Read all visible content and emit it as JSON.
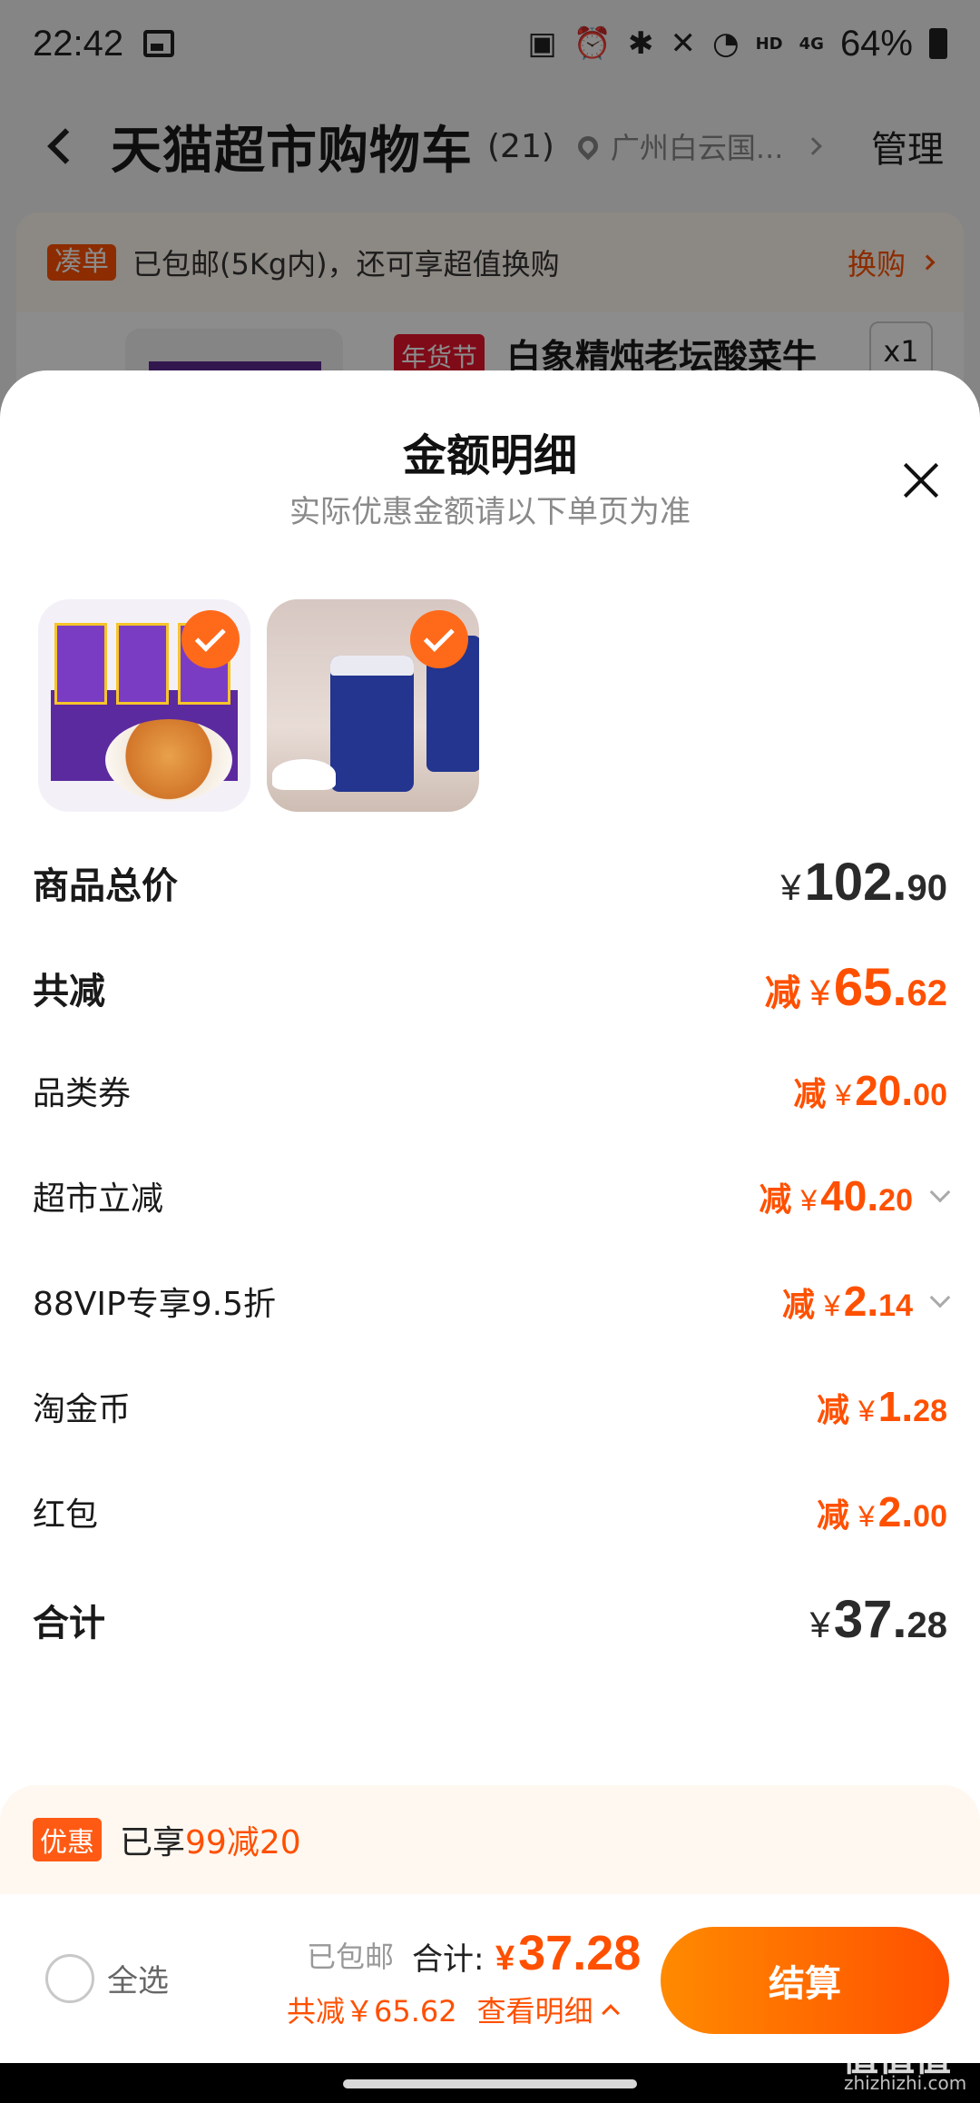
{
  "status_bar": {
    "time": "22:42",
    "battery": "64%",
    "icons": [
      "image-icon",
      "battery-saver-icon",
      "alarm-icon",
      "bluetooth-icon",
      "mute-icon",
      "wifi-icon",
      "hd-icon",
      "4g-signal-icon",
      "battery-icon"
    ],
    "hd": "HD",
    "net": "4G"
  },
  "header": {
    "title": "天猫超市购物车",
    "count": "(21)",
    "address": "广州白云国...",
    "manage": "管理"
  },
  "cart": {
    "promo_tag": "凑单",
    "promo_text": "已包邮(5Kg内)，还可享超值换购",
    "promo_link": "换购",
    "item_tag": "年货节",
    "item_title": "白象精炖老坛酸菜牛",
    "item_qty": "x1"
  },
  "sheet": {
    "title": "金额明细",
    "subtitle": "实际优惠金额请以下单页为准",
    "products": [
      {
        "name": "白象老坛酸菜牛肉面"
      },
      {
        "name": "海盐"
      }
    ],
    "rows": {
      "subtotal": {
        "label": "商品总价",
        "yen": "¥",
        "int": "102.",
        "dec": "90"
      },
      "total_discount": {
        "label": "共减",
        "prefix": "减",
        "yen": "¥",
        "int": "65.",
        "dec": "62"
      },
      "category_coupon": {
        "label": "品类券",
        "prefix": "减",
        "yen": "¥",
        "int": "20.",
        "dec": "00"
      },
      "instant_discount": {
        "label": "超市立减",
        "prefix": "减",
        "yen": "¥",
        "int": "40.",
        "dec": "20"
      },
      "vip_discount": {
        "label": "88VIP专享9.5折",
        "prefix": "减",
        "yen": "¥",
        "int": "2.",
        "dec": "14"
      },
      "taojin_coins": {
        "label": "淘金币",
        "prefix": "减",
        "yen": "¥",
        "int": "1.",
        "dec": "28"
      },
      "red_packet": {
        "label": "红包",
        "prefix": "减",
        "yen": "¥",
        "int": "2.",
        "dec": "00"
      },
      "total": {
        "label": "合计",
        "yen": "¥",
        "int": "37.",
        "dec": "28"
      }
    }
  },
  "bottom": {
    "coupon_tag": "优惠",
    "coupon_text": "已享",
    "coupon_highlight": "99减20",
    "select_all": "全选",
    "free_ship": "已包邮",
    "total_label": "合计:",
    "total_yen": "¥",
    "total_amount": "37.28",
    "saved_text": "共减￥65.62",
    "detail_link": "查看明细",
    "checkout": "结算"
  },
  "watermark": {
    "text": "值值值",
    "sub": "zhizhizhi.com"
  },
  "colors": {
    "accent": "#ff5000",
    "button_start": "#ff8a00",
    "button_end": "#ff5000"
  }
}
